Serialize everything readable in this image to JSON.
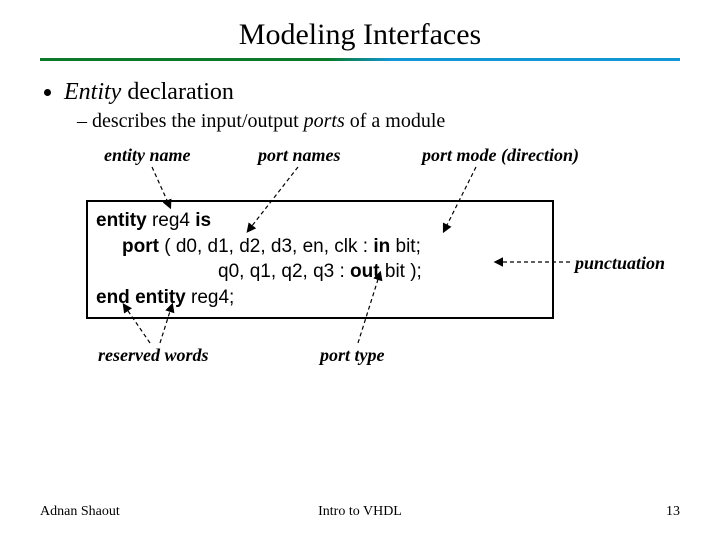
{
  "title": "Modeling Interfaces",
  "bullet1_italic": "Entity",
  "bullet1_rest": " declaration",
  "bullet2_pre": "describes the input/output ",
  "bullet2_italic": "ports",
  "bullet2_post": " of a module",
  "labels": {
    "entity_name": "entity name",
    "port_names": "port names",
    "port_mode": "port mode (direction)",
    "punctuation": "punctuation",
    "reserved_words": "reserved words",
    "port_type": "port type"
  },
  "code": {
    "l1a": "entity",
    "l1b": " reg4 ",
    "l1c": "is",
    "l2a": "port",
    "l2b": " ( d0, d1, d2, d3, en, clk : ",
    "l2c": "in",
    "l2d": " bit;",
    "l3a": "q0, q1, q2, q3 : ",
    "l3b": "out",
    "l3c": " bit );",
    "l4a": "end",
    "l4b": " ",
    "l4c": "entity",
    "l4d": " reg4;"
  },
  "footer": {
    "left": "Adnan Shaout",
    "center": "Intro to VHDL",
    "right": "13"
  }
}
